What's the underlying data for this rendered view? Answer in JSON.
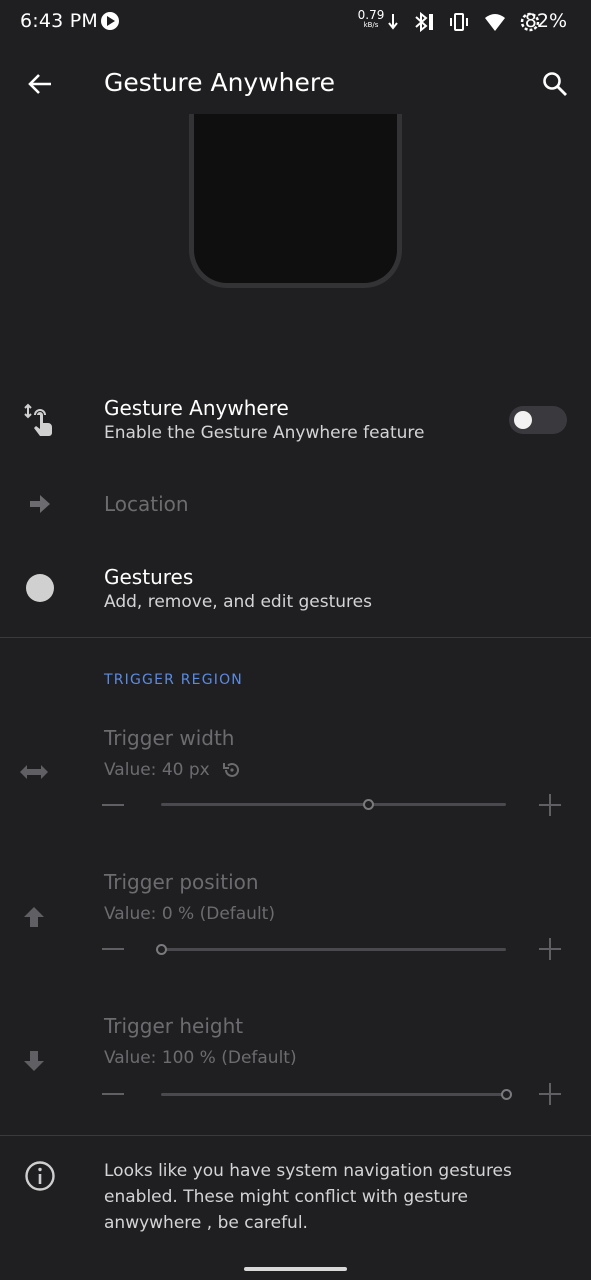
{
  "status_bar": {
    "time": "6:43 PM",
    "net_speed_value": "0.79",
    "net_speed_unit": "kB/s",
    "battery_percent": "82%",
    "icons": [
      "media-icon",
      "download-arrow-icon",
      "bluetooth-icon",
      "vibrate-icon",
      "wifi-icon",
      "battery-saver-icon"
    ]
  },
  "app_bar": {
    "title": "Gesture Anywhere",
    "back_icon": "arrow-left-icon",
    "search_icon": "search-icon"
  },
  "preferences": {
    "gesture_anywhere": {
      "title": "Gesture Anywhere",
      "summary": "Enable the Gesture Anywhere feature",
      "enabled": false
    },
    "location": {
      "title": "Location"
    },
    "gestures": {
      "title": "Gestures",
      "summary": "Add, remove, and edit gestures"
    }
  },
  "trigger_region": {
    "header": "TRIGGER REGION",
    "sliders": [
      {
        "title": "Trigger width",
        "value_text": "Value: 40 px",
        "fraction": 0.6,
        "has_reset": true
      },
      {
        "title": "Trigger position",
        "value_text": "Value: 0 % (Default)",
        "fraction": 0.0,
        "has_reset": false
      },
      {
        "title": "Trigger height",
        "value_text": "Value: 100 % (Default)",
        "fraction": 1.0,
        "has_reset": false
      }
    ]
  },
  "info": {
    "text": "Looks like you have system navigation gestures enabled. These might conflict with gesture anwywhere , be careful."
  },
  "colors": {
    "background": "#1f1f21",
    "accent": "#5b8be0",
    "disabled_text": "#6c6c70"
  }
}
